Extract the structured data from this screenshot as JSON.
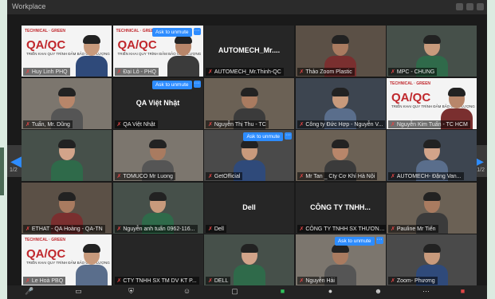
{
  "window": {
    "title": "Workplace"
  },
  "nav": {
    "prev": "◀",
    "next": "▶",
    "page_left": "1/2",
    "page_right": "1/2"
  },
  "unmute_label": "Ask to unmute",
  "more_label": "···",
  "colors": {
    "accent": "#2d8cff",
    "brand_red": "#c0282d"
  },
  "banner": {
    "logo": "TECHNICAL · GREEN",
    "title": "QA/QC",
    "sub": "TRIỂN KHAI QUY TRÌNH ĐẢM BẢO CHẤT LƯỢNG"
  },
  "tiles": [
    {
      "name": "Huy Linh PHQ",
      "type": "banner"
    },
    {
      "name": "Đại Lô - PHQ",
      "type": "banner",
      "unmute": true
    },
    {
      "name": "AUTOMECH_Mr.Thinh-QC",
      "type": "text",
      "center": "AUTOMECH_Mr...."
    },
    {
      "name": "Thảo Zoom Plastic",
      "type": "person"
    },
    {
      "name": "MPC - CHUNG",
      "type": "person"
    },
    {
      "name": "Tuấn, Mr. Dũng",
      "type": "person"
    },
    {
      "name": "QA Việt Nhật",
      "type": "text",
      "center": "QA Việt Nhật",
      "unmute": true
    },
    {
      "name": "Nguyễn Thị Thu - TC",
      "type": "person"
    },
    {
      "name": "Công ty Đức Hợp - Nguyễn V...",
      "type": "person"
    },
    {
      "name": "Nguyễn Kim Tuấn - TC HCM",
      "type": "banner"
    },
    {
      "name": "",
      "type": "person"
    },
    {
      "name": "TOMUCO Mr Luong",
      "type": "person"
    },
    {
      "name": "GetOfficial",
      "type": "person",
      "unmute": true
    },
    {
      "name": "Mr Tan _ Cty Cơ Khí Hà Nội",
      "type": "person"
    },
    {
      "name": "AUTOMECH- Đặng Van...",
      "type": "person"
    },
    {
      "name": "ETHAT - QA Hoàng - QA-TN",
      "type": "person"
    },
    {
      "name": "Nguyễn anh tuấn 0962-116...",
      "type": "person"
    },
    {
      "name": "Dell",
      "type": "text",
      "center": "Dell"
    },
    {
      "name": "CÔNG TY TNHH SX THƯƠNG ...",
      "type": "text",
      "center": "CÔNG TY TNHH..."
    },
    {
      "name": "Pauline Mr Tiến",
      "type": "person"
    },
    {
      "name": "Le Hoà PBQ",
      "type": "banner"
    },
    {
      "name": "CTY TNHH SX TM DV KT P...",
      "type": "text",
      "center": ""
    },
    {
      "name": "DELL",
      "type": "person"
    },
    {
      "name": "Nguyễn Hải",
      "type": "person",
      "unmute": true
    },
    {
      "name": "Zoom- Phương",
      "type": "person"
    }
  ]
}
